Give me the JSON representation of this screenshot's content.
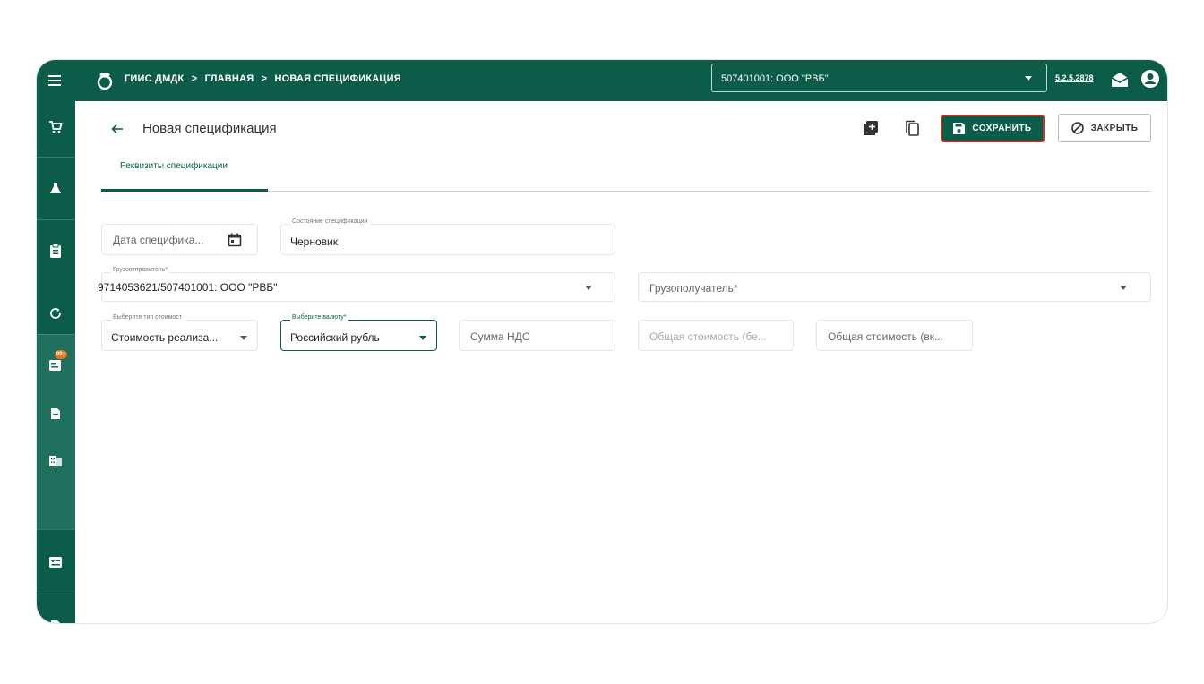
{
  "header": {
    "breadcrumbs": [
      "ГИИС ДМДК",
      ">",
      "ГЛАВНАЯ",
      ">",
      "НОВАЯ СПЕЦИФИКАЦИЯ"
    ],
    "org_select_value": "507401001: ООО \"РВБ\"",
    "version": "5.2.5.2878"
  },
  "page": {
    "title": "Новая спецификация",
    "save_label": "СОХРАНИТЬ",
    "close_label": "ЗАКРЫТЬ",
    "tab_label": "Реквизиты спецификации"
  },
  "form": {
    "spec_date": {
      "placeholder": "Дата специфика..."
    },
    "spec_state": {
      "label": "Состояние спецификации",
      "value": "Черновик"
    },
    "shipper": {
      "label": "Грузоотправитель*",
      "value": "9714053621/507401001: ООО \"РВБ\""
    },
    "consignee": {
      "placeholder": "Грузополучатель*"
    },
    "cost_type": {
      "label": "Выберите тип стоимост",
      "value": "Стоимость реализа..."
    },
    "currency": {
      "label": "Выберите валюту*",
      "value": "Российский рубль"
    },
    "vat_sum": {
      "placeholder": "Сумма НДС"
    },
    "total_excl": {
      "placeholder": "Общая стоимость (бе..."
    },
    "total_incl": {
      "placeholder": "Общая стоимость (вк..."
    }
  },
  "sidebar": {
    "icons": [
      "cart-icon",
      "flask-icon",
      "clipboard-icon",
      "sync-icon",
      "notification-card-icon",
      "document-icon",
      "buildings-icon",
      "checklist-icon",
      "file-icon"
    ],
    "badge": "99+"
  },
  "colors": {
    "primary": "#0b5c49",
    "sidebar_highlight": "#1f6f5d",
    "badge": "#e8731a",
    "save_border": "#c0392b"
  }
}
